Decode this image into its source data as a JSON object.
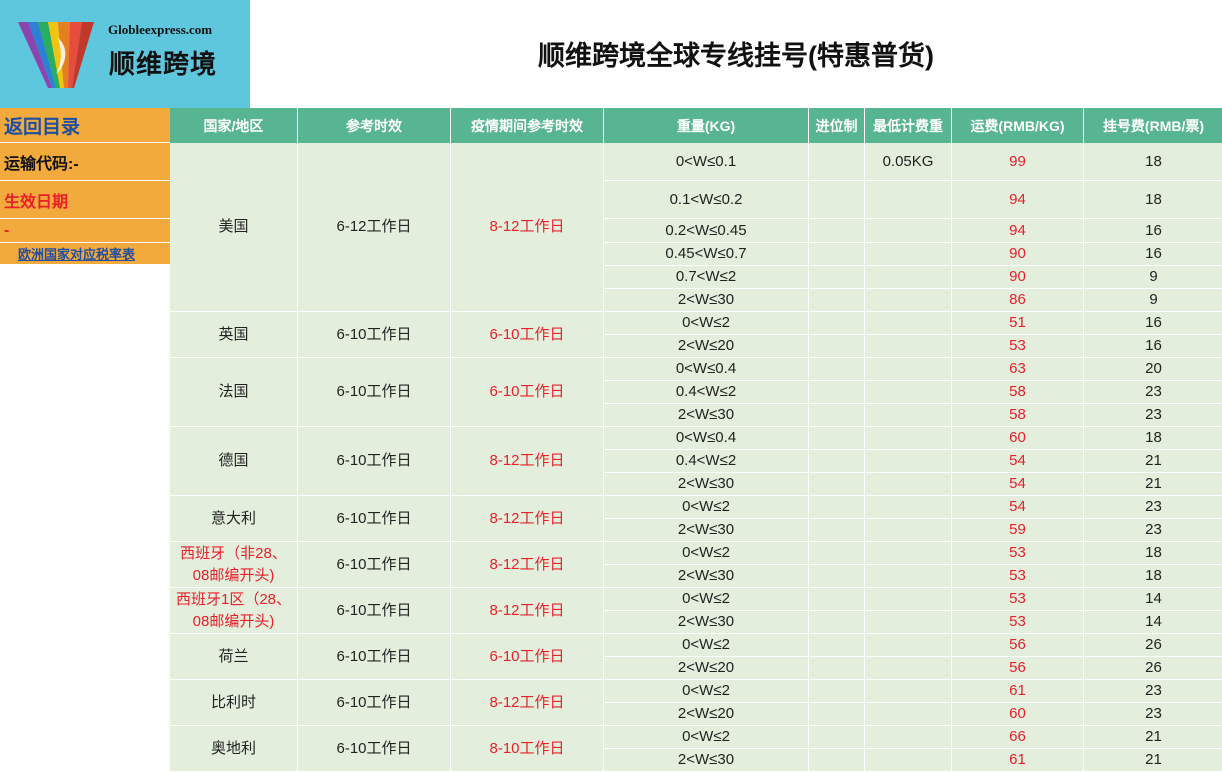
{
  "logo": {
    "en": "Globleexpress.com",
    "cn": "顺维跨境"
  },
  "title": "顺维跨境全球专线挂号(特惠普货)",
  "sidebar": {
    "back": "返回目录",
    "code": "运输代码:-",
    "date": "生效日期",
    "dash": "-",
    "link": "欧洲国家对应税率表"
  },
  "headers": [
    "国家/地区",
    "参考时效",
    "疫情期间参考时效",
    "重量(KG)",
    "进位制",
    "最低计费重",
    "运费(RMB/KG)",
    "挂号费(RMB/票)"
  ],
  "groups": [
    {
      "country": "美国",
      "ref": "6-12工作日",
      "covid": "8-12工作日",
      "country_red": false,
      "rows": [
        {
          "w": "0<W≤0.1",
          "min": "0.05KG",
          "rate": "99",
          "fee": "18"
        },
        {
          "w": "0.1<W≤0.2",
          "min": "",
          "rate": "94",
          "fee": "18"
        },
        {
          "w": "0.2<W≤0.45",
          "min": "",
          "rate": "94",
          "fee": "16"
        },
        {
          "w": "0.45<W≤0.7",
          "min": "",
          "rate": "90",
          "fee": "16"
        },
        {
          "w": "0.7<W≤2",
          "min": "",
          "rate": "90",
          "fee": "9"
        },
        {
          "w": "2<W≤30",
          "min": "",
          "rate": "86",
          "fee": "9"
        }
      ]
    },
    {
      "country": "英国",
      "ref": "6-10工作日",
      "covid": "6-10工作日",
      "country_red": false,
      "rows": [
        {
          "w": "0<W≤2",
          "min": "",
          "rate": "51",
          "fee": "16"
        },
        {
          "w": "2<W≤20",
          "min": "",
          "rate": "53",
          "fee": "16"
        }
      ]
    },
    {
      "country": "法国",
      "ref": "6-10工作日",
      "covid": "6-10工作日",
      "country_red": false,
      "rows": [
        {
          "w": "0<W≤0.4",
          "min": "",
          "rate": "63",
          "fee": "20"
        },
        {
          "w": "0.4<W≤2",
          "min": "",
          "rate": "58",
          "fee": "23"
        },
        {
          "w": "2<W≤30",
          "min": "",
          "rate": "58",
          "fee": "23"
        }
      ]
    },
    {
      "country": "德国",
      "ref": "6-10工作日",
      "covid": "8-12工作日",
      "country_red": false,
      "rows": [
        {
          "w": "0<W≤0.4",
          "min": "",
          "rate": "60",
          "fee": "18"
        },
        {
          "w": "0.4<W≤2",
          "min": "",
          "rate": "54",
          "fee": "21"
        },
        {
          "w": "2<W≤30",
          "min": "",
          "rate": "54",
          "fee": "21"
        }
      ]
    },
    {
      "country": "意大利",
      "ref": "6-10工作日",
      "covid": "8-12工作日",
      "country_red": false,
      "rows": [
        {
          "w": "0<W≤2",
          "min": "",
          "rate": "54",
          "fee": "23"
        },
        {
          "w": "2<W≤30",
          "min": "",
          "rate": "59",
          "fee": "23"
        }
      ]
    },
    {
      "country": "西班牙（非28、08邮编开头)",
      "ref": "6-10工作日",
      "covid": "8-12工作日",
      "country_red": true,
      "rows": [
        {
          "w": "0<W≤2",
          "min": "",
          "rate": "53",
          "fee": "18"
        },
        {
          "w": "2<W≤30",
          "min": "",
          "rate": "53",
          "fee": "18"
        }
      ]
    },
    {
      "country": "西班牙1区（28、08邮编开头)",
      "ref": "6-10工作日",
      "covid": "8-12工作日",
      "country_red": true,
      "rows": [
        {
          "w": "0<W≤2",
          "min": "",
          "rate": "53",
          "fee": "14"
        },
        {
          "w": "2<W≤30",
          "min": "",
          "rate": "53",
          "fee": "14"
        }
      ]
    },
    {
      "country": "荷兰",
      "ref": "6-10工作日",
      "covid": "6-10工作日",
      "country_red": false,
      "rows": [
        {
          "w": "0<W≤2",
          "min": "",
          "rate": "56",
          "fee": "26"
        },
        {
          "w": "2<W≤20",
          "min": "",
          "rate": "56",
          "fee": "26"
        }
      ]
    },
    {
      "country": "比利时",
      "ref": "6-10工作日",
      "covid": "8-12工作日",
      "country_red": false,
      "rows": [
        {
          "w": "0<W≤2",
          "min": "",
          "rate": "61",
          "fee": "23"
        },
        {
          "w": "2<W≤20",
          "min": "",
          "rate": "60",
          "fee": "23"
        }
      ]
    },
    {
      "country": "奥地利",
      "ref": "6-10工作日",
      "covid": "8-10工作日",
      "country_red": false,
      "rows": [
        {
          "w": "0<W≤2",
          "min": "",
          "rate": "66",
          "fee": "21"
        },
        {
          "w": "2<W≤30",
          "min": "",
          "rate": "61",
          "fee": "21"
        }
      ]
    }
  ],
  "colors": {
    "header": "#58b591",
    "cell": "#e3efdc",
    "logo_bg": "#5fc7dd",
    "sidebar": "#f2aa3c",
    "accent_red": "#e8202a"
  }
}
